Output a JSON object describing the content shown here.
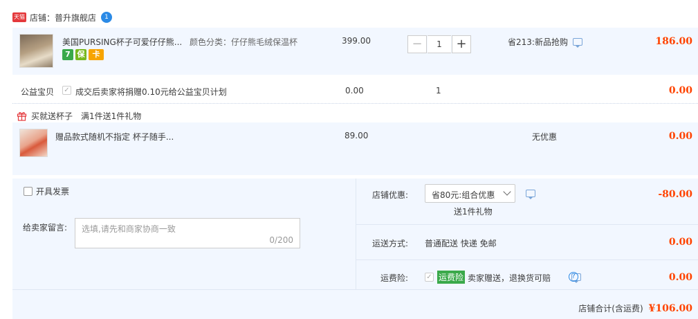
{
  "shop": {
    "badge": "天猫",
    "label": "店铺：普升旗舰店",
    "chat_badge": "1"
  },
  "item1": {
    "title": "美国PURSING杯子可爱仔仔熊...",
    "sku": "颜色分类：仔仔熊毛绒保温杯",
    "price": "399.00",
    "quantity": "1",
    "promo": "省213:新品抢购",
    "total": "186.00",
    "tags": [
      "7",
      "保",
      "卡"
    ]
  },
  "charity": {
    "label": "公益宝贝",
    "text": "成交后卖家将捐赠0.10元给公益宝贝计划",
    "price": "0.00",
    "quantity": "1",
    "total": "0.00"
  },
  "gift": {
    "title": "买就送杯子",
    "rule": "满1件送1件礼物",
    "item_title": "赠品款式随机不指定 杯子随手...",
    "price": "89.00",
    "promo": "无优惠",
    "total": "0.00"
  },
  "invoice": {
    "label": "开具发票"
  },
  "message": {
    "label": "给卖家留言:",
    "placeholder": "选填,请先和商家协商一致",
    "counter": "0/200"
  },
  "discount": {
    "label": "店铺优惠:",
    "selected": "省80元:组合优惠",
    "note": "送1件礼物",
    "amount": "-80.00"
  },
  "shipping": {
    "label": "运送方式:",
    "value": "普通配送 快递 免邮",
    "amount": "0.00"
  },
  "insurance": {
    "label": "运费险:",
    "badge": "运费险",
    "text": "卖家赠送，退换货可赔",
    "amount": "0.00"
  },
  "summary": {
    "label": "店铺合计(含运费)",
    "amount": "¥106.00"
  },
  "colors": {
    "accent_red": "#ff4400",
    "panel_bg": "#f2f7ff",
    "insurance_green": "#3aa94a"
  }
}
